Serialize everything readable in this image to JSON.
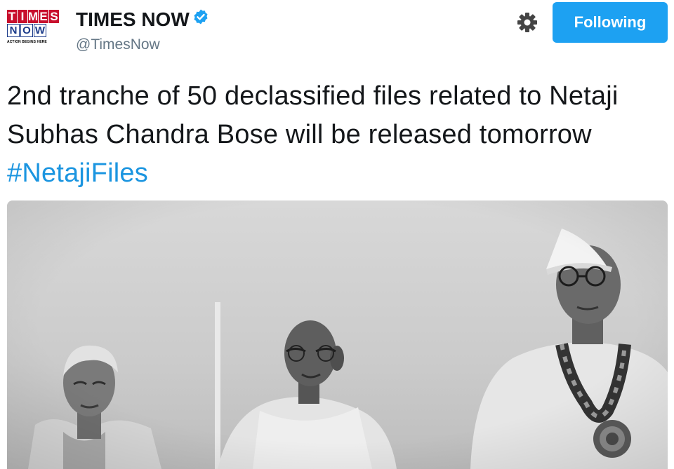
{
  "account": {
    "logo_top": [
      "T",
      "I",
      "M",
      "E",
      "S"
    ],
    "logo_bottom": [
      "N",
      "O",
      "W"
    ],
    "logo_tagline": "ACTION BEGINS HERE",
    "display_name": "TIMES NOW",
    "handle": "@TimesNow",
    "verified": true
  },
  "actions": {
    "follow_label": "Following",
    "gear_icon": "gear-icon"
  },
  "tweet": {
    "text": "2nd tranche of 50 declassified files related to Netaji Subhas Chandra Bose will be released tomorrow ",
    "hashtag": "#NetajiFiles"
  },
  "colors": {
    "accent": "#1da1f2",
    "hashtag": "#1b95e0",
    "handle": "#657786",
    "logo_red": "#c8102e",
    "logo_blue": "#1b3b8a"
  }
}
